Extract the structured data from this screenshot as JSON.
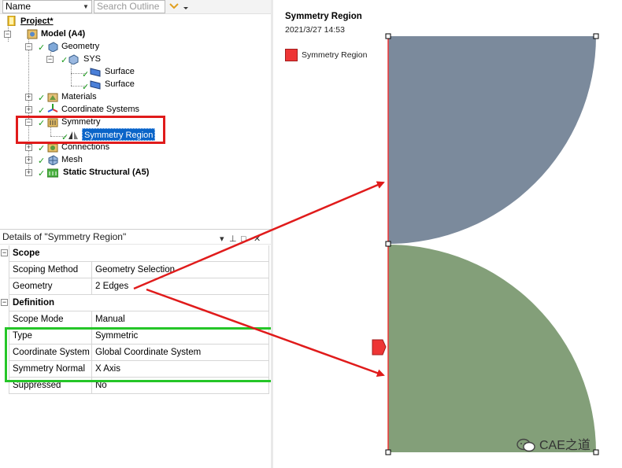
{
  "toolbar": {
    "name_label": "Name",
    "search_placeholder": "Search Outline"
  },
  "tree": {
    "project": "Project*",
    "model": "Model (A4)",
    "geometry": "Geometry",
    "sys": "SYS",
    "surface1": "Surface",
    "surface2": "Surface",
    "materials": "Materials",
    "coordinate_systems": "Coordinate Systems",
    "symmetry": "Symmetry",
    "symmetry_region": "Symmetry Region",
    "connections": "Connections",
    "mesh": "Mesh",
    "static_structural": "Static Structural (A5)"
  },
  "details": {
    "title": "Details of \"Symmetry Region\"",
    "scope_header": "Scope",
    "rows_scope": [
      {
        "label": "Scoping Method",
        "value": "Geometry Selection"
      },
      {
        "label": "Geometry",
        "value": "2 Edges"
      }
    ],
    "definition_header": "Definition",
    "rows_definition": [
      {
        "label": "Scope Mode",
        "value": "Manual"
      },
      {
        "label": "Type",
        "value": "Symmetric"
      },
      {
        "label": "Coordinate System",
        "value": "Global Coordinate System"
      },
      {
        "label": "Symmetry Normal",
        "value": "X Axis"
      },
      {
        "label": "Suppressed",
        "value": "No"
      }
    ]
  },
  "graphics": {
    "title": "Symmetry Region",
    "timestamp": "2021/3/27 14:53",
    "legend_label": "Symmetry Region",
    "watermark": "CAE之道"
  },
  "colors": {
    "selection": "#0a64c8",
    "highlight_red": "#e01b1b",
    "highlight_green": "#25c628",
    "upper_body": "#7b8a9c",
    "lower_body": "#839f79",
    "symmetry_edge": "#ee3535"
  }
}
